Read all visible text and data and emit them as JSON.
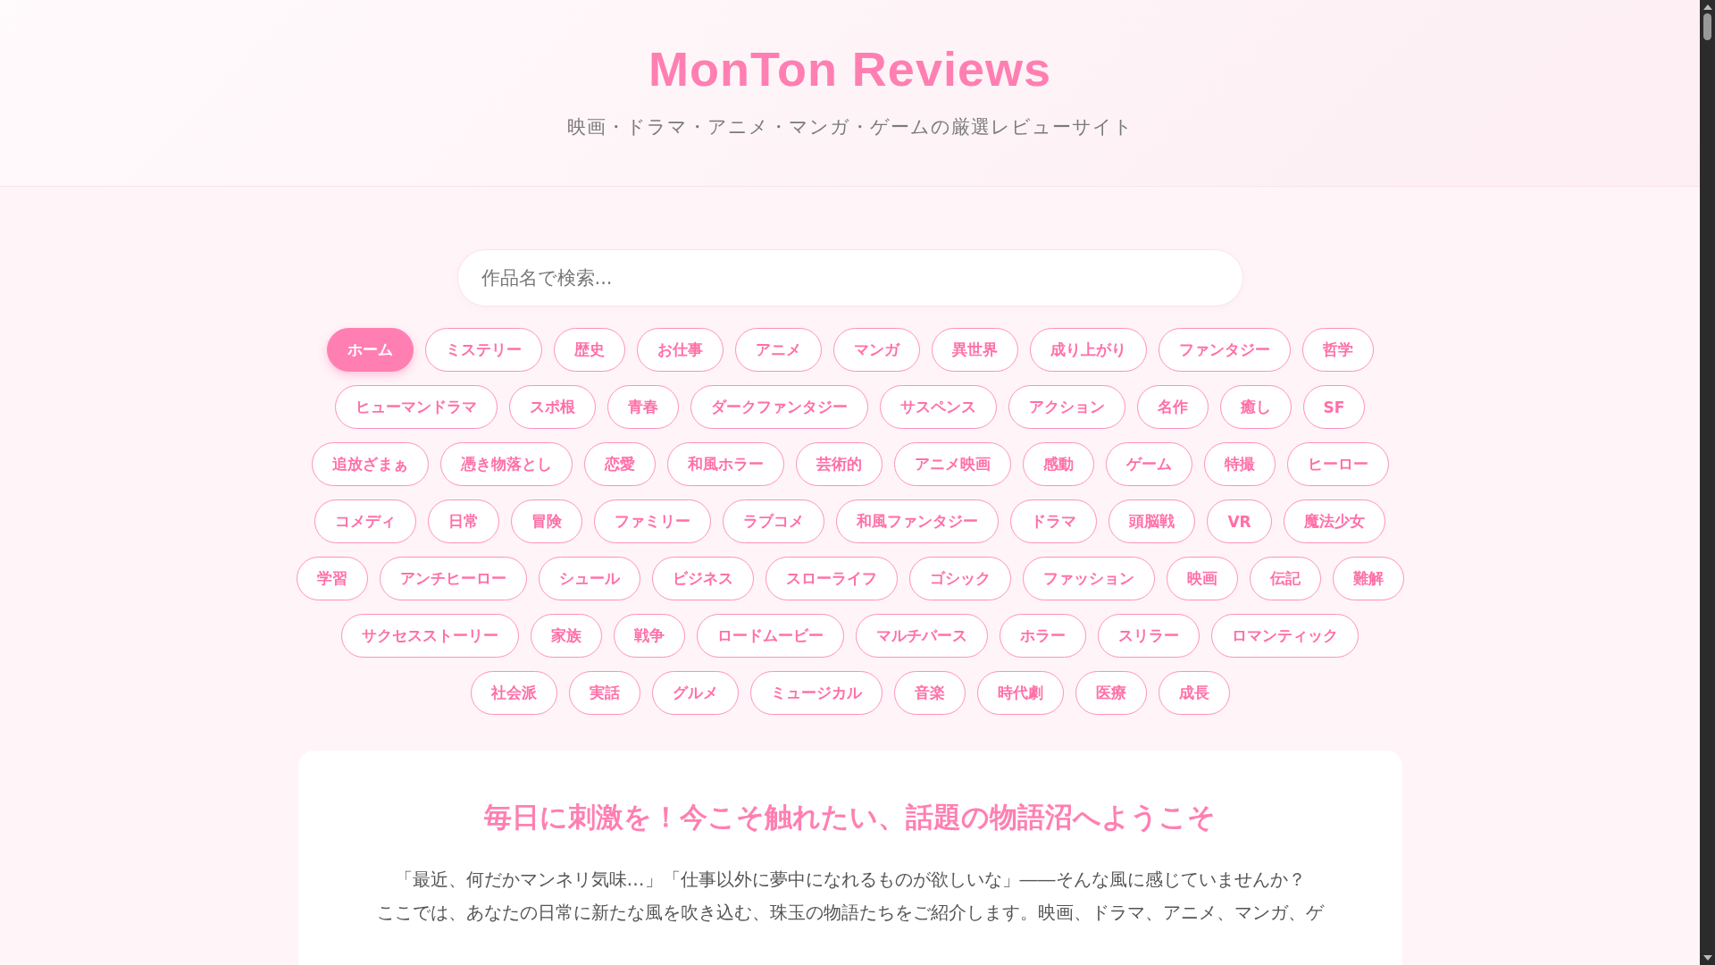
{
  "header": {
    "title": "MonTon Reviews",
    "subtitle": "映画・ドラマ・アニメ・マンガ・ゲームの厳選レビューサイト"
  },
  "search": {
    "placeholder": "作品名で検索..."
  },
  "tags": [
    {
      "label": "ホーム",
      "selected": true
    },
    {
      "label": "ミステリー",
      "selected": false
    },
    {
      "label": "歴史",
      "selected": false
    },
    {
      "label": "お仕事",
      "selected": false
    },
    {
      "label": "アニメ",
      "selected": false
    },
    {
      "label": "マンガ",
      "selected": false
    },
    {
      "label": "異世界",
      "selected": false
    },
    {
      "label": "成り上がり",
      "selected": false
    },
    {
      "label": "ファンタジー",
      "selected": false
    },
    {
      "label": "哲学",
      "selected": false
    },
    {
      "label": "ヒューマンドラマ",
      "selected": false
    },
    {
      "label": "スポ根",
      "selected": false
    },
    {
      "label": "青春",
      "selected": false
    },
    {
      "label": "ダークファンタジー",
      "selected": false
    },
    {
      "label": "サスペンス",
      "selected": false
    },
    {
      "label": "アクション",
      "selected": false
    },
    {
      "label": "名作",
      "selected": false
    },
    {
      "label": "癒し",
      "selected": false
    },
    {
      "label": "SF",
      "selected": false
    },
    {
      "label": "追放ざまぁ",
      "selected": false
    },
    {
      "label": "憑き物落とし",
      "selected": false
    },
    {
      "label": "恋愛",
      "selected": false
    },
    {
      "label": "和風ホラー",
      "selected": false
    },
    {
      "label": "芸術的",
      "selected": false
    },
    {
      "label": "アニメ映画",
      "selected": false
    },
    {
      "label": "感動",
      "selected": false
    },
    {
      "label": "ゲーム",
      "selected": false
    },
    {
      "label": "特撮",
      "selected": false
    },
    {
      "label": "ヒーロー",
      "selected": false
    },
    {
      "label": "コメディ",
      "selected": false
    },
    {
      "label": "日常",
      "selected": false
    },
    {
      "label": "冒険",
      "selected": false
    },
    {
      "label": "ファミリー",
      "selected": false
    },
    {
      "label": "ラブコメ",
      "selected": false
    },
    {
      "label": "和風ファンタジー",
      "selected": false
    },
    {
      "label": "ドラマ",
      "selected": false
    },
    {
      "label": "頭脳戦",
      "selected": false
    },
    {
      "label": "VR",
      "selected": false
    },
    {
      "label": "魔法少女",
      "selected": false
    },
    {
      "label": "学習",
      "selected": false
    },
    {
      "label": "アンチヒーロー",
      "selected": false
    },
    {
      "label": "シュール",
      "selected": false
    },
    {
      "label": "ビジネス",
      "selected": false
    },
    {
      "label": "スローライフ",
      "selected": false
    },
    {
      "label": "ゴシック",
      "selected": false
    },
    {
      "label": "ファッション",
      "selected": false
    },
    {
      "label": "映画",
      "selected": false
    },
    {
      "label": "伝記",
      "selected": false
    },
    {
      "label": "難解",
      "selected": false
    },
    {
      "label": "サクセスストーリー",
      "selected": false
    },
    {
      "label": "家族",
      "selected": false
    },
    {
      "label": "戦争",
      "selected": false
    },
    {
      "label": "ロードムービー",
      "selected": false
    },
    {
      "label": "マルチバース",
      "selected": false
    },
    {
      "label": "ホラー",
      "selected": false
    },
    {
      "label": "スリラー",
      "selected": false
    },
    {
      "label": "ロマンティック",
      "selected": false
    },
    {
      "label": "社会派",
      "selected": false
    },
    {
      "label": "実話",
      "selected": false
    },
    {
      "label": "グルメ",
      "selected": false
    },
    {
      "label": "ミュージカル",
      "selected": false
    },
    {
      "label": "音楽",
      "selected": false
    },
    {
      "label": "時代劇",
      "selected": false
    },
    {
      "label": "医療",
      "selected": false
    },
    {
      "label": "成長",
      "selected": false
    }
  ],
  "intro": {
    "heading": "毎日に刺激を！今こそ触れたい、話題の物語沼へようこそ",
    "lines": [
      "「最近、何だかマンネリ気味…」「仕事以外に夢中になれるものが欲しいな」――そんな風に感じていませんか？",
      "ここでは、あなたの日常に新たな風を吹き込む、珠玉の物語たちをご紹介します。映画、ドラマ、アニメ、マンガ、ゲ"
    ]
  }
}
